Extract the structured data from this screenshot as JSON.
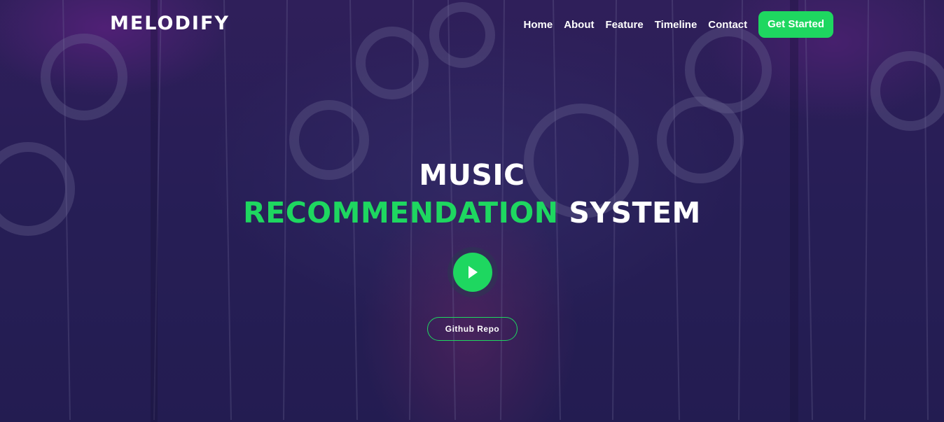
{
  "brand": {
    "logo": "MELODIFY"
  },
  "nav": {
    "items": [
      {
        "label": "Home"
      },
      {
        "label": "About"
      },
      {
        "label": "Feature"
      },
      {
        "label": "Timeline"
      },
      {
        "label": "Contact"
      }
    ],
    "cta_label": "Get Started"
  },
  "hero": {
    "title_line1": "MUSIC",
    "title_accent": "RECOMMENDATION",
    "title_rest": "SYSTEM",
    "play_icon": "play-icon",
    "repo_label": "Github Repo"
  },
  "colors": {
    "accent": "#1ed760",
    "background": "#2d2360",
    "text": "#ffffff"
  }
}
